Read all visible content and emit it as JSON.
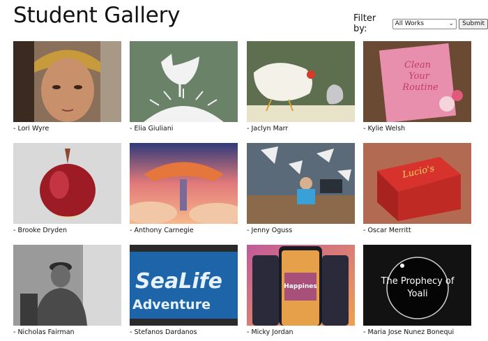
{
  "page": {
    "title": "Student Gallery"
  },
  "filter": {
    "label": "Filter by:",
    "selected": "All Works",
    "submit": "Submit"
  },
  "gallery": [
    {
      "caption": "- Lori Wyre"
    },
    {
      "caption": "- Elia Giuliani"
    },
    {
      "caption": "- Jaclyn Marr"
    },
    {
      "caption": "- Kylie Welsh",
      "art_text": [
        "Clean",
        "Your",
        "Routine"
      ]
    },
    {
      "caption": "- Brooke Dryden"
    },
    {
      "caption": "- Anthony Carnegie"
    },
    {
      "caption": "- Jenny Oguss"
    },
    {
      "caption": "- Oscar Merritt",
      "art_text": "Lucio's"
    },
    {
      "caption": "- Nicholas Fairman"
    },
    {
      "caption": "- Stefanos Dardanos",
      "art_text": [
        "SeaLife",
        "Adventure"
      ]
    },
    {
      "caption": "- Micky Jordan",
      "art_text": "Happines"
    },
    {
      "caption": "- Maria Jose Nunez Bonequi",
      "art_text": [
        "The Prophecy of",
        "Yoali"
      ]
    }
  ]
}
